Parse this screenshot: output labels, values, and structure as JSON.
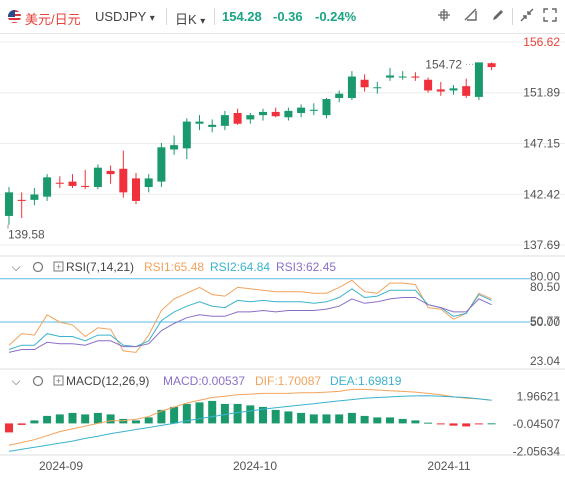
{
  "toolbar": {
    "pair_label": "美元/日元",
    "symbol": "USDJPY",
    "symbol_caret": "▾",
    "period": "日K",
    "period_caret": "▾",
    "last_price": "154.28",
    "change": "-0.36",
    "change_pct": "-0.24%",
    "colors": {
      "pair": "#e8423a",
      "up": "#1aa583",
      "down": "#e8423a"
    },
    "icons": [
      "crosshair-icon",
      "measure-icon",
      "draw-icon",
      "fullscreen-icon"
    ]
  },
  "colors": {
    "up": "#1a9a6c",
    "down": "#f0303a",
    "rsi1": "#f2a35c",
    "rsi2": "#3bb3cf",
    "rsi3": "#8a6fc8",
    "dif": "#f2a35c",
    "dea": "#3bb3cf",
    "ref_line": "#5bb8e8",
    "grid": "#ececec"
  },
  "price_panel": {
    "axis_labels": [
      "156.62",
      "151.89",
      "147.15",
      "142.42",
      "137.69"
    ],
    "axis_values": [
      156.62,
      151.89,
      147.15,
      142.42,
      137.69
    ],
    "high_label": "154.72",
    "low_label": "139.58",
    "current_price": 154.28
  },
  "rsi_panel": {
    "title": "RSI(7,14,21)",
    "rsi1_label": "RSI1:65.48",
    "rsi2_label": "RSI2:64.84",
    "rsi3_label": "RSI3:62.45",
    "axis_labels": [
      "80.00",
      "80.50",
      "50.00",
      "50.77",
      "23.04"
    ],
    "axis_values": [
      80.0,
      80.5,
      50.0,
      50.77,
      23.04
    ]
  },
  "macd_panel": {
    "title": "MACD(12,26,9)",
    "macd_label": "MACD:0.00537",
    "dif_label": "DIF:1.70087",
    "dea_label": "DEA:1.69819",
    "axis_labels": [
      "1.96621",
      "-0.04507",
      "-2.05634"
    ],
    "axis_values": [
      1.96621,
      -0.04507,
      -2.05634
    ]
  },
  "x_axis": {
    "labels": [
      "2024-09",
      "2024-10",
      "2024-11"
    ]
  },
  "chart_data": {
    "type": "candlestick",
    "candles": [
      {
        "o": 140.4,
        "h": 143.1,
        "l": 139.58,
        "c": 142.6
      },
      {
        "o": 141.9,
        "h": 142.6,
        "l": 140.2,
        "c": 141.8
      },
      {
        "o": 141.9,
        "h": 143.0,
        "l": 141.4,
        "c": 142.4
      },
      {
        "o": 142.2,
        "h": 144.3,
        "l": 141.8,
        "c": 144.0
      },
      {
        "o": 143.5,
        "h": 144.1,
        "l": 143.0,
        "c": 143.4
      },
      {
        "o": 143.6,
        "h": 144.3,
        "l": 143.0,
        "c": 143.2
      },
      {
        "o": 143.2,
        "h": 144.7,
        "l": 142.9,
        "c": 143.1
      },
      {
        "o": 143.1,
        "h": 145.2,
        "l": 142.9,
        "c": 144.9
      },
      {
        "o": 144.6,
        "h": 145.1,
        "l": 143.4,
        "c": 144.3
      },
      {
        "o": 144.8,
        "h": 146.5,
        "l": 142.1,
        "c": 142.6
      },
      {
        "o": 143.9,
        "h": 144.4,
        "l": 141.5,
        "c": 141.8
      },
      {
        "o": 143.1,
        "h": 144.3,
        "l": 142.6,
        "c": 143.9
      },
      {
        "o": 143.6,
        "h": 147.2,
        "l": 143.1,
        "c": 146.8
      },
      {
        "o": 146.6,
        "h": 147.9,
        "l": 146.1,
        "c": 147.0
      },
      {
        "o": 146.7,
        "h": 149.5,
        "l": 145.7,
        "c": 149.2
      },
      {
        "o": 149.0,
        "h": 149.8,
        "l": 148.4,
        "c": 149.2
      },
      {
        "o": 148.7,
        "h": 149.4,
        "l": 148.2,
        "c": 148.9
      },
      {
        "o": 148.8,
        "h": 150.2,
        "l": 148.4,
        "c": 149.8
      },
      {
        "o": 150.0,
        "h": 150.4,
        "l": 148.9,
        "c": 149.0
      },
      {
        "o": 149.4,
        "h": 150.0,
        "l": 149.0,
        "c": 149.8
      },
      {
        "o": 149.8,
        "h": 150.4,
        "l": 149.3,
        "c": 150.1
      },
      {
        "o": 150.1,
        "h": 150.5,
        "l": 149.6,
        "c": 149.7
      },
      {
        "o": 149.6,
        "h": 150.5,
        "l": 149.3,
        "c": 150.2
      },
      {
        "o": 150.0,
        "h": 150.8,
        "l": 149.6,
        "c": 150.5
      },
      {
        "o": 150.2,
        "h": 150.9,
        "l": 149.8,
        "c": 150.3
      },
      {
        "o": 149.8,
        "h": 151.4,
        "l": 149.5,
        "c": 151.3
      },
      {
        "o": 151.4,
        "h": 152.1,
        "l": 151.0,
        "c": 151.8
      },
      {
        "o": 151.4,
        "h": 153.9,
        "l": 151.2,
        "c": 153.4
      },
      {
        "o": 153.1,
        "h": 153.6,
        "l": 152.0,
        "c": 152.4
      },
      {
        "o": 152.4,
        "h": 152.9,
        "l": 151.8,
        "c": 152.4
      },
      {
        "o": 153.3,
        "h": 154.2,
        "l": 153.0,
        "c": 153.5
      },
      {
        "o": 153.4,
        "h": 153.9,
        "l": 153.1,
        "c": 153.4
      },
      {
        "o": 153.4,
        "h": 153.8,
        "l": 153.0,
        "c": 153.3
      },
      {
        "o": 153.1,
        "h": 153.3,
        "l": 151.9,
        "c": 152.1
      },
      {
        "o": 152.2,
        "h": 152.9,
        "l": 151.6,
        "c": 152.0
      },
      {
        "o": 152.1,
        "h": 152.6,
        "l": 151.7,
        "c": 152.3
      },
      {
        "o": 152.5,
        "h": 153.2,
        "l": 151.4,
        "c": 151.6
      },
      {
        "o": 151.5,
        "h": 154.7,
        "l": 151.2,
        "c": 154.72
      },
      {
        "o": 154.64,
        "h": 154.72,
        "l": 154.0,
        "c": 154.28
      }
    ],
    "rsi1": [
      34,
      42,
      41,
      55,
      50,
      48,
      40,
      46,
      45,
      30,
      29,
      41,
      58,
      66,
      70,
      74,
      69,
      68,
      74,
      73,
      72,
      71,
      71,
      71,
      70,
      70,
      74,
      79,
      71,
      70,
      77,
      77,
      76,
      60,
      59,
      52,
      56,
      70,
      66
    ],
    "rsi2": [
      31,
      34,
      34,
      42,
      40,
      40,
      37,
      41,
      41,
      34,
      33,
      37,
      51,
      57,
      61,
      64,
      61,
      60,
      65,
      64,
      65,
      64,
      64,
      64,
      63,
      64,
      67,
      73,
      67,
      68,
      72,
      72,
      72,
      62,
      60,
      54,
      56,
      69,
      65
    ],
    "rsi3": [
      29,
      31,
      31,
      36,
      35,
      35,
      34,
      37,
      37,
      33,
      33,
      35,
      44,
      49,
      53,
      55,
      54,
      54,
      57,
      57,
      58,
      57,
      58,
      58,
      58,
      59,
      61,
      66,
      63,
      64,
      66,
      67,
      67,
      62,
      60,
      57,
      57,
      66,
      62
    ],
    "macd": [
      -0.6,
      -0.1,
      0.2,
      0.5,
      0.6,
      0.7,
      0.6,
      0.7,
      0.6,
      0.3,
      0.2,
      0.4,
      0.9,
      1.1,
      1.3,
      1.4,
      1.5,
      1.3,
      1.3,
      1.2,
      1.1,
      0.9,
      0.8,
      0.7,
      0.6,
      0.6,
      0.6,
      0.7,
      0.5,
      0.4,
      0.4,
      0.3,
      0.2,
      0.05,
      -0.02,
      -0.15,
      -0.2,
      -0.06,
      0.00537
    ],
    "dif": [
      -1.6,
      -1.4,
      -1.2,
      -0.9,
      -0.6,
      -0.4,
      -0.2,
      0.0,
      0.2,
      0.2,
      0.3,
      0.5,
      0.9,
      1.2,
      1.5,
      1.7,
      1.9,
      2.0,
      2.1,
      2.15,
      2.2,
      2.2,
      2.2,
      2.25,
      2.25,
      2.3,
      2.35,
      2.5,
      2.5,
      2.45,
      2.4,
      2.35,
      2.3,
      2.2,
      2.1,
      1.95,
      1.85,
      1.8,
      1.70087
    ],
    "dea": [
      -2.05634,
      -1.9,
      -1.75,
      -1.6,
      -1.45,
      -1.3,
      -1.1,
      -0.95,
      -0.75,
      -0.6,
      -0.45,
      -0.3,
      -0.15,
      0.0,
      0.2,
      0.35,
      0.5,
      0.65,
      0.8,
      0.9,
      1.05,
      1.15,
      1.25,
      1.35,
      1.45,
      1.55,
      1.65,
      1.75,
      1.85,
      1.9,
      1.95,
      2.0,
      2.02,
      2.03,
      2.0,
      1.95,
      1.9,
      1.8,
      1.69819
    ]
  }
}
